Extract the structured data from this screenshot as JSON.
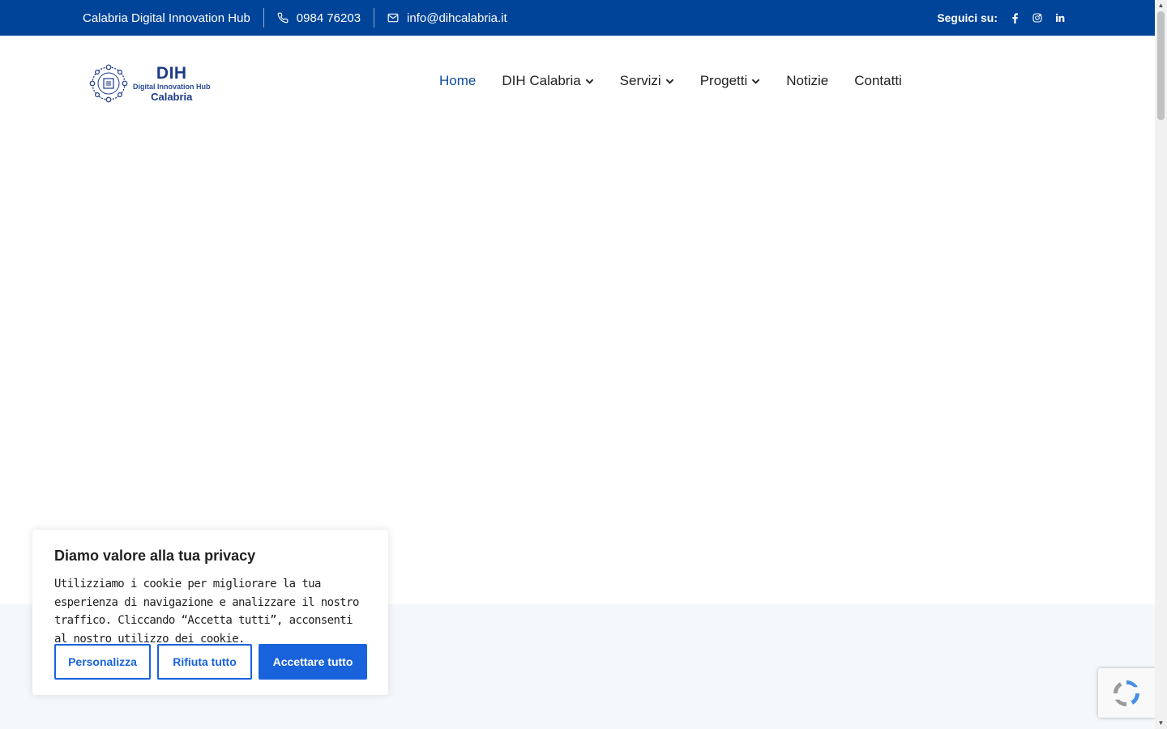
{
  "topbar": {
    "org_name": "Calabria Digital Innovation Hub",
    "phone": "0984 76203",
    "email": "info@dihcalabria.it",
    "follow_label": "Seguici su:",
    "socials": [
      "facebook-icon",
      "instagram-icon",
      "linkedin-icon"
    ],
    "bg_color": "#00449a"
  },
  "logo": {
    "line1": "DIH",
    "line2": "Digital Innovation Hub",
    "line3": "Calabria"
  },
  "nav": {
    "items": [
      {
        "label": "Home",
        "active": true,
        "has_dropdown": false
      },
      {
        "label": "DIH Calabria",
        "active": false,
        "has_dropdown": true
      },
      {
        "label": "Servizi",
        "active": false,
        "has_dropdown": true
      },
      {
        "label": "Progetti",
        "active": false,
        "has_dropdown": true
      },
      {
        "label": "Notizie",
        "active": false,
        "has_dropdown": false
      },
      {
        "label": "Contatti",
        "active": false,
        "has_dropdown": false
      }
    ],
    "active_color": "#0d4a9e"
  },
  "cookie_banner": {
    "title": "Diamo valore alla tua privacy",
    "body": "Utilizziamo i cookie per migliorare la tua esperienza di navigazione e analizzare il nostro traffico. Cliccando “Accetta tutti”, acconsenti al nostro utilizzo dei cookie.",
    "customize_label": "Personalizza",
    "reject_label": "Rifiuta tutto",
    "accept_label": "Accettare tutto",
    "accent_color": "#1863dc"
  }
}
